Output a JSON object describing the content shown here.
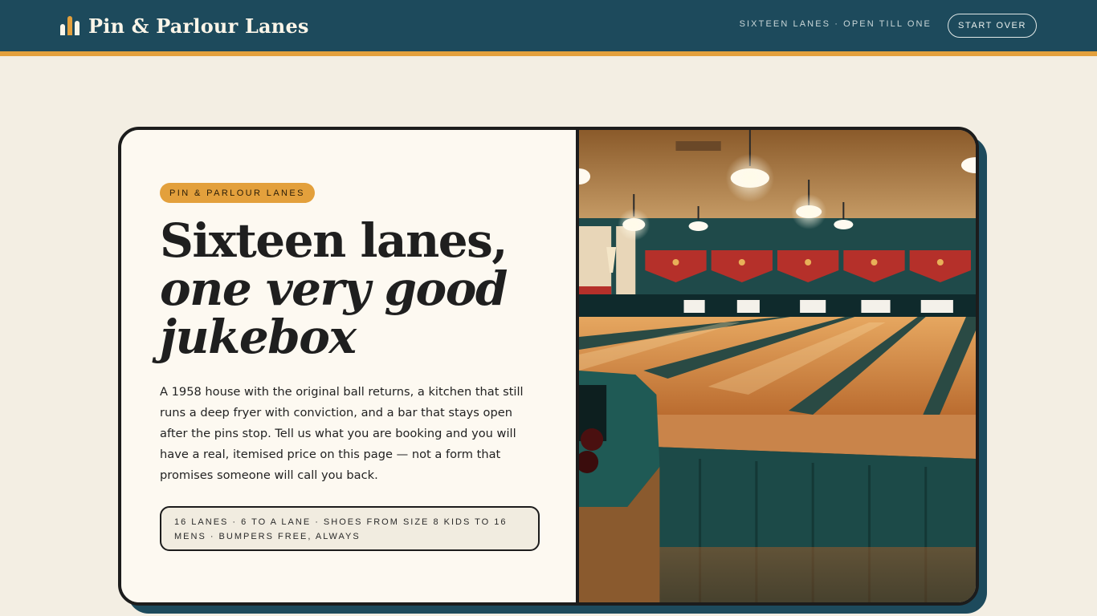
{
  "header": {
    "brand_name": "Pin & Parlour Lanes",
    "brand_icon": "bowling-pins-icon",
    "tagline": "SIXTEEN LANES · OPEN TILL ONE",
    "start_over_label": "START OVER"
  },
  "hero": {
    "pill": "PIN & PARLOUR LANES",
    "headline_line1": "Sixteen lanes,",
    "headline_line2": "one very good jukebox",
    "body": "A 1958 house with the original ball returns, a kitchen that still runs a deep fryer with conviction, and a bar that stays open after the pins stop. Tell us what you are booking and you will have a real, itemised price on this page — not a form that promises someone will call you back.",
    "specs": "16 LANES · 6 TO A LANE · SHOES FROM SIZE 8 KIDS TO 16 MENS · BUMPERS FREE, ALWAYS"
  },
  "colors": {
    "header_bg": "#1d4a5c",
    "accent": "#e3a03c",
    "page_bg": "#f3eee3",
    "card_bg": "#fdf9f1",
    "ink": "#1c1c1c"
  }
}
